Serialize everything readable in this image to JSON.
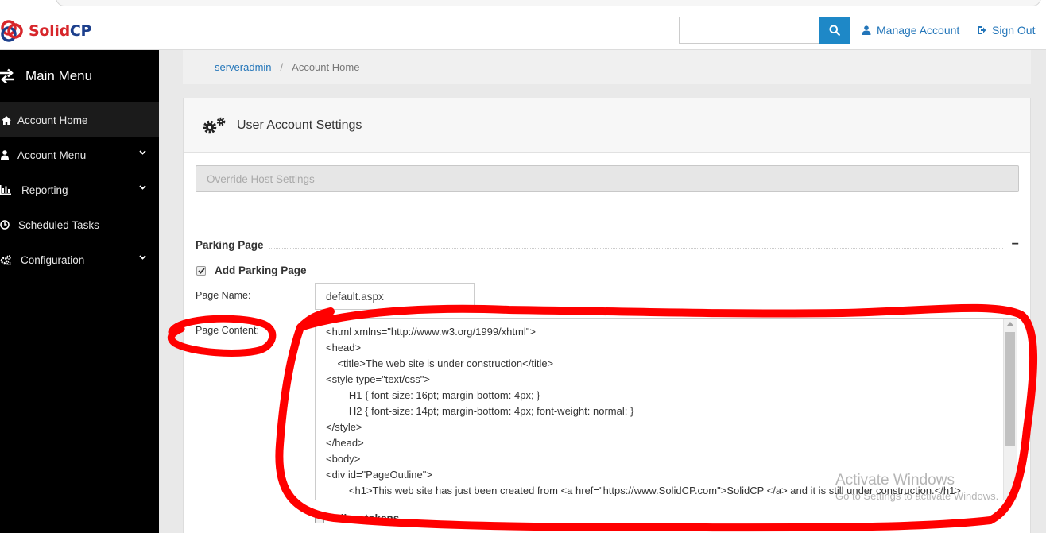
{
  "brand": {
    "logo_red": "Solid",
    "logo_blue": "CP",
    "color_red": "#d7262b",
    "color_blue": "#1c3f8c"
  },
  "header": {
    "search_placeholder": "",
    "manage_account": "Manage Account",
    "sign_out": "Sign Out",
    "accent": "#1e88c7"
  },
  "sidebar": {
    "title": "Main Menu",
    "items": [
      {
        "label": "Account Home",
        "icon": "home-icon",
        "active": true
      },
      {
        "label": "Account Menu",
        "icon": "user-icon",
        "expandable": true
      },
      {
        "label": "Reporting",
        "icon": "bar-chart-icon",
        "expandable": true
      },
      {
        "label": "Scheduled Tasks",
        "icon": "clock-icon"
      },
      {
        "label": "Configuration",
        "icon": "cogs-icon",
        "expandable": true
      }
    ]
  },
  "breadcrumb": {
    "user": "serveradmin",
    "separator": "/",
    "current": "Account Home"
  },
  "panel": {
    "title": "User Account Settings",
    "override_button": "Override Host Settings",
    "parking": {
      "section_title": "Parking Page",
      "collapse": "−",
      "add_parking_label": "Add Parking Page",
      "add_parking_checked": true,
      "page_name_label": "Page Name:",
      "page_name_value": "default.aspx",
      "page_content_label": "Page Content:",
      "content_lines": [
        "<html xmlns=\"http://www.w3.org/1999/xhtml\">",
        "<head>",
        "    <title>The web site is under construction</title>",
        "<style type=\"text/css\">",
        "        H1 { font-size: 16pt; margin-bottom: 4px; }",
        "        H2 { font-size: 14pt; margin-bottom: 4px; font-weight: normal; }",
        "</style>",
        "</head>",
        "<body>",
        "<div id=\"PageOutline\">",
        "        <h1>This web site has just been created from <a href=\"https://www.SolidCP.com\">SolidCP </a> and it is still under construction.</h1>"
      ],
      "allow_tokens_label": "Allow tokens",
      "allow_tokens_checked": false
    }
  },
  "watermark": {
    "line1": "Activate Windows",
    "line2": "Go to Settings to activate Windows."
  },
  "annotation_color": "#ff0000"
}
